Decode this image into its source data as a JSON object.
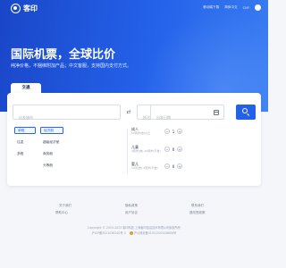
{
  "brand": {
    "name": "客印"
  },
  "topnav": {
    "download": "移动端下载",
    "language": "简体中文",
    "currency": "CNY"
  },
  "hero": {
    "title": "国际机票，全球比价",
    "subtitle": "纯净价格，不捆绑附加产品；中文客服，支持国内支付方式。"
  },
  "search": {
    "tab": "交通",
    "from_placeholder": "出发城市",
    "to_placeholder": "抵达城市",
    "date_placeholder": "出发日期"
  },
  "options": {
    "col1": [
      "单程",
      "往返",
      "多程"
    ],
    "col2": [
      "经济舱",
      "超级经济舱",
      "商务舱",
      "头等舱"
    ]
  },
  "passengers": [
    {
      "label": "成人",
      "note": "12周岁(含)以上",
      "count": "1"
    },
    {
      "label": "儿童",
      "note": "2周岁(含)-12周岁(不含)",
      "count": "0"
    },
    {
      "label": "婴儿",
      "note": "14天(含)-2周岁(不含)",
      "count": "0"
    }
  ],
  "footer": {
    "links": [
      "关于我们",
      "隐私政策",
      "联系我们",
      "帮助中心",
      "用户协议",
      "退改签政策",
      "意见反馈"
    ],
    "copyright": "Copyright © 2019-2023 客印科技 上海客印信息技术有限公司版权所有",
    "icp": "沪ICP备2021036240号-3",
    "police": "沪公网安备31011502018806号"
  },
  "colors": {
    "primary": "#2361e8",
    "hero": "#1a46c8"
  }
}
